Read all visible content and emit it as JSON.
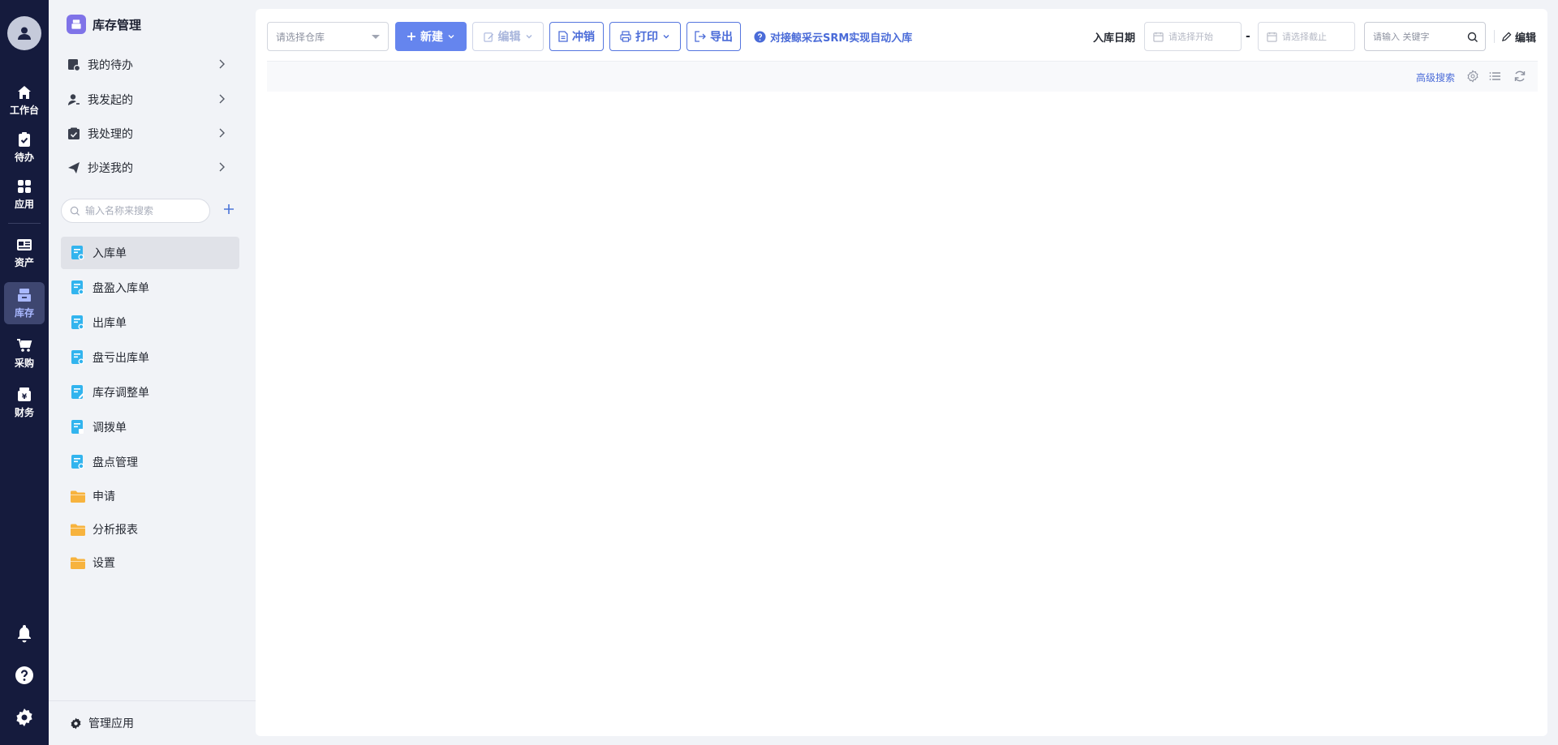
{
  "rail": {
    "items": [
      {
        "label": "工作台",
        "icon": "home-icon"
      },
      {
        "label": "待办",
        "icon": "clipboard-check-icon"
      },
      {
        "label": "应用",
        "icon": "apps-grid-icon"
      },
      {
        "label": "资产",
        "icon": "asset-card-icon"
      },
      {
        "label": "库存",
        "icon": "inventory-icon",
        "active": true
      },
      {
        "label": "采购",
        "icon": "cart-icon"
      },
      {
        "label": "财务",
        "icon": "finance-wallet-icon"
      }
    ],
    "bottom": [
      "bell-icon",
      "help-icon",
      "settings-gear-icon"
    ]
  },
  "app": {
    "title": "库存管理",
    "logo_color": "#7f73e8"
  },
  "quick_links": [
    {
      "label": "我的待办",
      "icon": "todo-icon"
    },
    {
      "label": "我发起的",
      "icon": "user-initiated-icon"
    },
    {
      "label": "我处理的",
      "icon": "handled-icon"
    },
    {
      "label": "抄送我的",
      "icon": "paper-plane-icon"
    }
  ],
  "sidebar_search": {
    "placeholder": "输入名称来搜索"
  },
  "nav": [
    {
      "label": "入库单",
      "icon": "form-icon",
      "active": true
    },
    {
      "label": "盘盈入库单",
      "icon": "form-icon"
    },
    {
      "label": "出库单",
      "icon": "form-icon"
    },
    {
      "label": "盘亏出库单",
      "icon": "form-icon"
    },
    {
      "label": "库存调整单",
      "icon": "form-edit-icon"
    },
    {
      "label": "调拨单",
      "icon": "form-icon"
    },
    {
      "label": "盘点管理",
      "icon": "form-icon"
    },
    {
      "label": "申请",
      "icon": "folder-icon"
    },
    {
      "label": "分析报表",
      "icon": "folder-icon"
    },
    {
      "label": "设置",
      "icon": "folder-icon"
    }
  ],
  "sidebar_footer": {
    "label": "管理应用"
  },
  "toolbar": {
    "warehouse_placeholder": "请选择仓库",
    "new_label": "新建",
    "edit_label": "编辑",
    "write_off_label": "冲销",
    "print_label": "打印",
    "export_label": "导出",
    "help_text": "对接鲸采云SRM实现自动入库",
    "date_label": "入库日期",
    "date_start_placeholder": "请选择开始",
    "date_sep": "-",
    "date_end_placeholder": "请选择截止",
    "keyword_placeholder": "请输入 关键字",
    "edit_view_label": "编辑"
  },
  "subbar": {
    "advanced_search": "高级搜索"
  },
  "colors": {
    "rail_bg": "#151b3d",
    "primary": "#6585ee",
    "link": "#4a6bd8",
    "form_icon": "#32b4ee",
    "folder_icon": "#f7b33e"
  }
}
